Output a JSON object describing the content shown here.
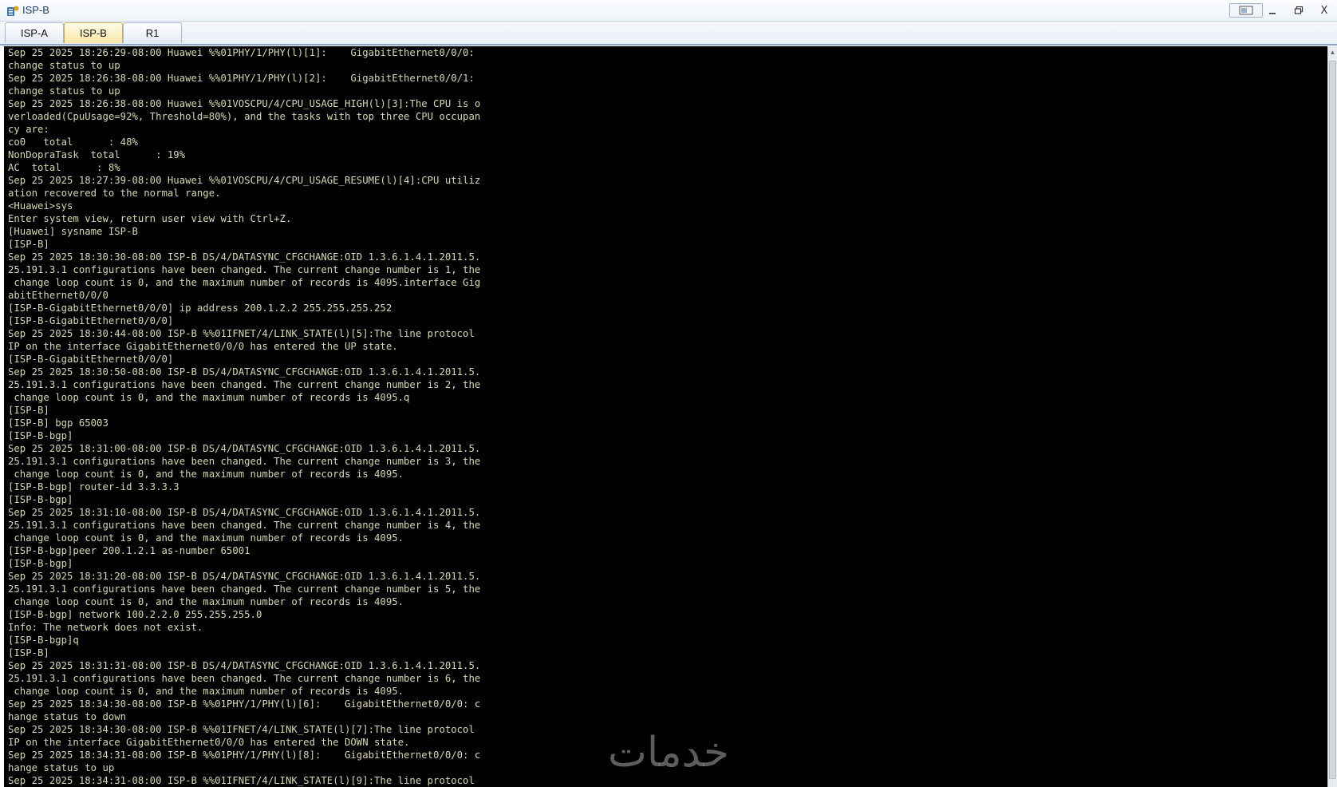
{
  "window": {
    "title": "ISP-B",
    "app_icon": "ensp-device-icon",
    "controls": [
      "restore-layout-icon",
      "minimize-icon",
      "maximize-icon",
      "close-icon"
    ],
    "close_label": "X"
  },
  "tabs": [
    {
      "label": "ISP-A",
      "active": false
    },
    {
      "label": "ISP-B",
      "active": true
    },
    {
      "label": "R1",
      "active": false
    }
  ],
  "terminal": {
    "text_color": "#d7d7ae",
    "background": "#000000",
    "lines": [
      "Sep 25 2025 18:26:29-08:00 Huawei %%01PHY/1/PHY(l)[1]:    GigabitEthernet0/0/0:",
      "change status to up",
      "Sep 25 2025 18:26:38-08:00 Huawei %%01PHY/1/PHY(l)[2]:    GigabitEthernet0/0/1:",
      "change status to up",
      "Sep 25 2025 18:26:38-08:00 Huawei %%01VOSCPU/4/CPU_USAGE_HIGH(l)[3]:The CPU is o",
      "verloaded(CpuUsage=92%, Threshold=80%), and the tasks with top three CPU occupan",
      "cy are:",
      "co0   total      : 48%",
      "NonDopraTask  total      : 19%",
      "AC  total      : 8%",
      "Sep 25 2025 18:27:39-08:00 Huawei %%01VOSCPU/4/CPU_USAGE_RESUME(l)[4]:CPU utiliz",
      "ation recovered to the normal range.",
      "<Huawei>sys",
      "Enter system view, return user view with Ctrl+Z.",
      "[Huawei] sysname ISP-B",
      "[ISP-B]",
      "Sep 25 2025 18:30:30-08:00 ISP-B DS/4/DATASYNC_CFGCHANGE:OID 1.3.6.1.4.1.2011.5.",
      "25.191.3.1 configurations have been changed. The current change number is 1, the",
      " change loop count is 0, and the maximum number of records is 4095.interface Gig",
      "abitEthernet0/0/0",
      "[ISP-B-GigabitEthernet0/0/0] ip address 200.1.2.2 255.255.255.252",
      "[ISP-B-GigabitEthernet0/0/0]",
      "Sep 25 2025 18:30:44-08:00 ISP-B %%01IFNET/4/LINK_STATE(l)[5]:The line protocol",
      "IP on the interface GigabitEthernet0/0/0 has entered the UP state.",
      "[ISP-B-GigabitEthernet0/0/0]",
      "Sep 25 2025 18:30:50-08:00 ISP-B DS/4/DATASYNC_CFGCHANGE:OID 1.3.6.1.4.1.2011.5.",
      "25.191.3.1 configurations have been changed. The current change number is 2, the",
      " change loop count is 0, and the maximum number of records is 4095.q",
      "[ISP-B]",
      "[ISP-B] bgp 65003",
      "[ISP-B-bgp]",
      "Sep 25 2025 18:31:00-08:00 ISP-B DS/4/DATASYNC_CFGCHANGE:OID 1.3.6.1.4.1.2011.5.",
      "25.191.3.1 configurations have been changed. The current change number is 3, the",
      " change loop count is 0, and the maximum number of records is 4095.",
      "[ISP-B-bgp] router-id 3.3.3.3",
      "[ISP-B-bgp]",
      "Sep 25 2025 18:31:10-08:00 ISP-B DS/4/DATASYNC_CFGCHANGE:OID 1.3.6.1.4.1.2011.5.",
      "25.191.3.1 configurations have been changed. The current change number is 4, the",
      " change loop count is 0, and the maximum number of records is 4095.",
      "[ISP-B-bgp]peer 200.1.2.1 as-number 65001",
      "[ISP-B-bgp]",
      "Sep 25 2025 18:31:20-08:00 ISP-B DS/4/DATASYNC_CFGCHANGE:OID 1.3.6.1.4.1.2011.5.",
      "25.191.3.1 configurations have been changed. The current change number is 5, the",
      " change loop count is 0, and the maximum number of records is 4095.",
      "[ISP-B-bgp] network 100.2.2.0 255.255.255.0",
      "Info: The network does not exist.",
      "[ISP-B-bgp]q",
      "[ISP-B]",
      "Sep 25 2025 18:31:31-08:00 ISP-B DS/4/DATASYNC_CFGCHANGE:OID 1.3.6.1.4.1.2011.5.",
      "25.191.3.1 configurations have been changed. The current change number is 6, the",
      " change loop count is 0, and the maximum number of records is 4095.",
      "Sep 25 2025 18:34:30-08:00 ISP-B %%01PHY/1/PHY(l)[6]:    GigabitEthernet0/0/0: c",
      "hange status to down",
      "Sep 25 2025 18:34:30-08:00 ISP-B %%01IFNET/4/LINK_STATE(l)[7]:The line protocol",
      "IP on the interface GigabitEthernet0/0/0 has entered the DOWN state.",
      "Sep 25 2025 18:34:31-08:00 ISP-B %%01PHY/1/PHY(l)[8]:    GigabitEthernet0/0/0: c",
      "hange status to up",
      "Sep 25 2025 18:34:31-08:00 ISP-B %%01IFNET/4/LINK_STATE(l)[9]:The line protocol"
    ]
  },
  "watermark": {
    "text": "خدمات"
  }
}
